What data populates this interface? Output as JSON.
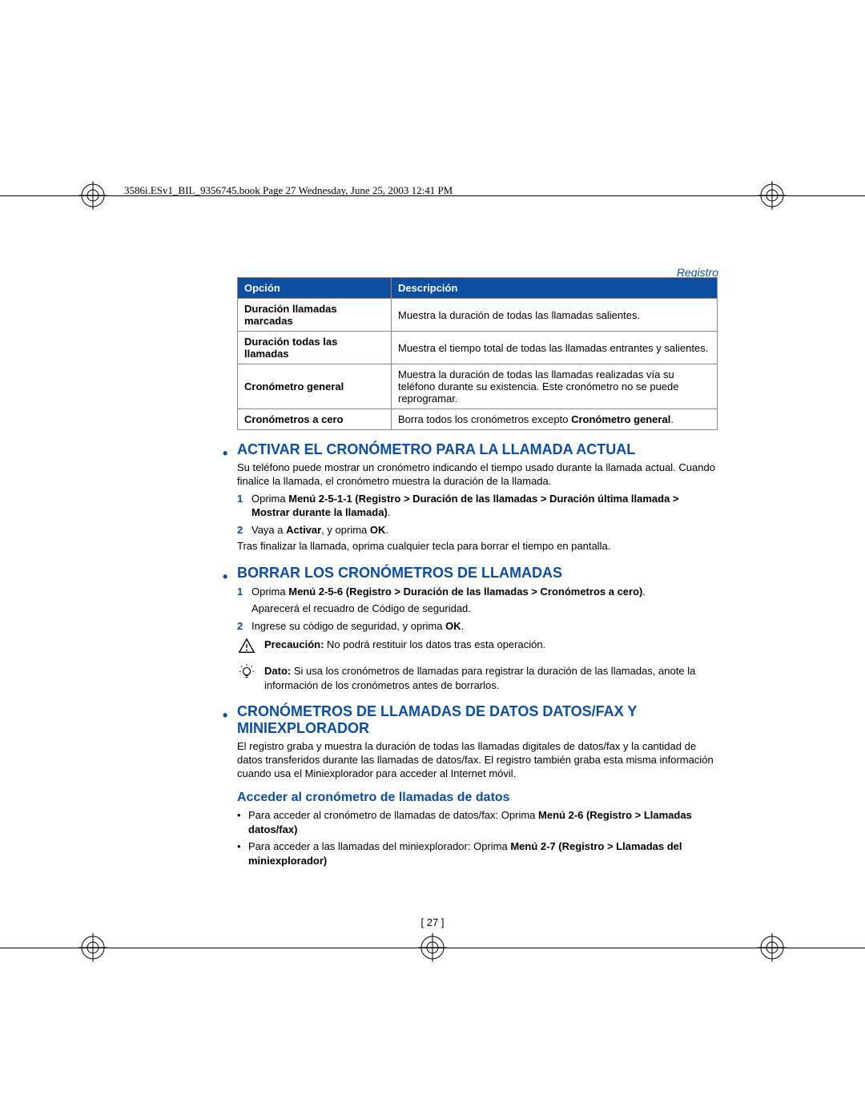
{
  "header_line": "3586i.ESv1_BIL_9356745.book  Page 27  Wednesday, June 25, 2003  12:41 PM",
  "breadcrumb": "Registro",
  "page_number": "[ 27 ]",
  "table": {
    "h1": "Opción",
    "h2": "Descripción",
    "rows": [
      {
        "opt": "Duración llamadas marcadas",
        "desc": "Muestra la duración de todas las llamadas salientes."
      },
      {
        "opt": "Duración todas las llamadas",
        "desc": "Muestra el tiempo total de todas las llamadas entrantes y salientes."
      },
      {
        "opt": "Cronómetro general",
        "desc": "Muestra la duración de todas las llamadas realizadas vía su teléfono durante su existencia. Este cronómetro no se puede reprogramar."
      },
      {
        "opt": "Cronómetros a cero",
        "desc_pre": "Borra todos los cronómetros excepto ",
        "desc_bold": "Cronómetro general",
        "desc_post": "."
      }
    ]
  },
  "s1": {
    "title": "ACTIVAR EL CRONÓMETRO PARA LA LLAMADA ACTUAL",
    "intro": "Su teléfono puede mostrar un cronómetro indicando el tiempo usado durante la llamada actual. Cuando finalice la llamada, el cronómetro muestra la duración de la llamada.",
    "step1_a": "Oprima ",
    "step1_b": "Menú 2-5-1-1 (Registro > Duración de las llamadas > Duración última llamada > Mostrar durante la llamada)",
    "step1_c": ".",
    "step2_a": "Vaya a ",
    "step2_b": "Activar",
    "step2_c": ", y oprima ",
    "step2_d": "OK",
    "step2_e": ".",
    "after": "Tras finalizar la llamada, oprima cualquier tecla para borrar el tiempo en pantalla."
  },
  "s2": {
    "title": "BORRAR LOS CRONÓMETROS DE LLAMADAS",
    "step1_a": "Oprima ",
    "step1_b": "Menú 2-5-6 (Registro > Duración de las llamadas > Cronómetros a cero)",
    "step1_c": ".",
    "step1_after": "Aparecerá el recuadro de Código de seguridad.",
    "step2_a": "Ingrese su código de seguridad, y oprima ",
    "step2_b": "OK",
    "step2_c": ".",
    "caution_label": "Precaución:",
    "caution_text": " No podrá restituir los datos tras esta operación.",
    "dato_label": "Dato:",
    "dato_text": " Si usa los cronómetros de llamadas para registrar la duración de las llamadas, anote la información de los cronómetros antes de borrarlos."
  },
  "s3": {
    "title": "CRONÓMETROS DE LLAMADAS DE DATOS DATOS/FAX Y MINIEXPLORADOR",
    "intro": "El registro graba y muestra la duración de todas las llamadas digitales de datos/fax y la cantidad de datos transferidos durante las llamadas de datos/fax. El registro también graba esta misma información cuando usa el Miniexplorador para acceder al Internet móvil.",
    "sub": "Acceder al cronómetro de llamadas de datos",
    "b1_a": "Para acceder al cronómetro de llamadas de datos/fax: Oprima ",
    "b1_b": "Menú 2-6 (Registro > Llamadas datos/fax)",
    "b2_a": "Para acceder a las llamadas del miniexplorador: Oprima ",
    "b2_b": "Menú 2-7 (Registro > Llamadas del miniexplorador)"
  }
}
